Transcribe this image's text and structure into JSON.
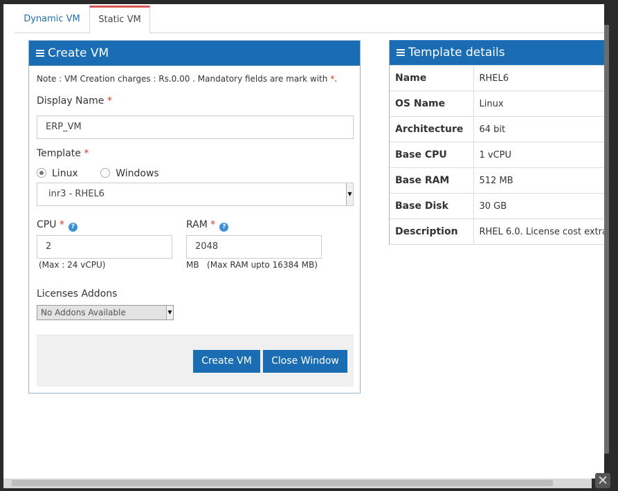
{
  "tabs": [
    {
      "label": "Dynamic VM",
      "active": false
    },
    {
      "label": "Static VM",
      "active": true
    }
  ],
  "create_panel": {
    "title": "Create VM",
    "note_prefix": "Note : VM Creation charges : Rs.0.00 . Mandatory fields are mark with ",
    "note_star": "*",
    "note_suffix": ".",
    "required_mark": "*",
    "display_name_label": "Display Name",
    "display_name_value": "ERP_VM",
    "template_label": "Template",
    "os_options": [
      {
        "label": "Linux",
        "selected": true
      },
      {
        "label": "Windows",
        "selected": false
      }
    ],
    "template_selected": "inr3 - RHEL6",
    "cpu_label": "CPU",
    "cpu_value": "2",
    "cpu_hint": "(Max : 24 vCPU)",
    "ram_label": "RAM",
    "ram_value": "2048",
    "ram_hint": "MB   (Max RAM upto 16384 MB)",
    "licenses_label": "Licenses Addons",
    "licenses_selected": "No Addons Available",
    "create_button": "Create VM",
    "close_button": "Close Window"
  },
  "template_panel": {
    "title": "Template details",
    "rows": [
      {
        "key": "Name",
        "value": "RHEL6"
      },
      {
        "key": "OS Name",
        "value": "Linux"
      },
      {
        "key": "Architecture",
        "value": "64 bit"
      },
      {
        "key": "Base CPU",
        "value": "1 vCPU"
      },
      {
        "key": "Base RAM",
        "value": "512 MB"
      },
      {
        "key": "Base Disk",
        "value": "30 GB"
      },
      {
        "key": "Description",
        "value": "RHEL 6.0. License cost extra"
      }
    ]
  },
  "icons": {
    "menu": "bars-icon",
    "help": "question-circle-icon",
    "close": "close-icon",
    "dropdown": "chevron-down-icon"
  },
  "colors": {
    "header_blue": "#1a6db3",
    "required_red": "#d9342b",
    "tab_active_border": "#d9534f"
  }
}
